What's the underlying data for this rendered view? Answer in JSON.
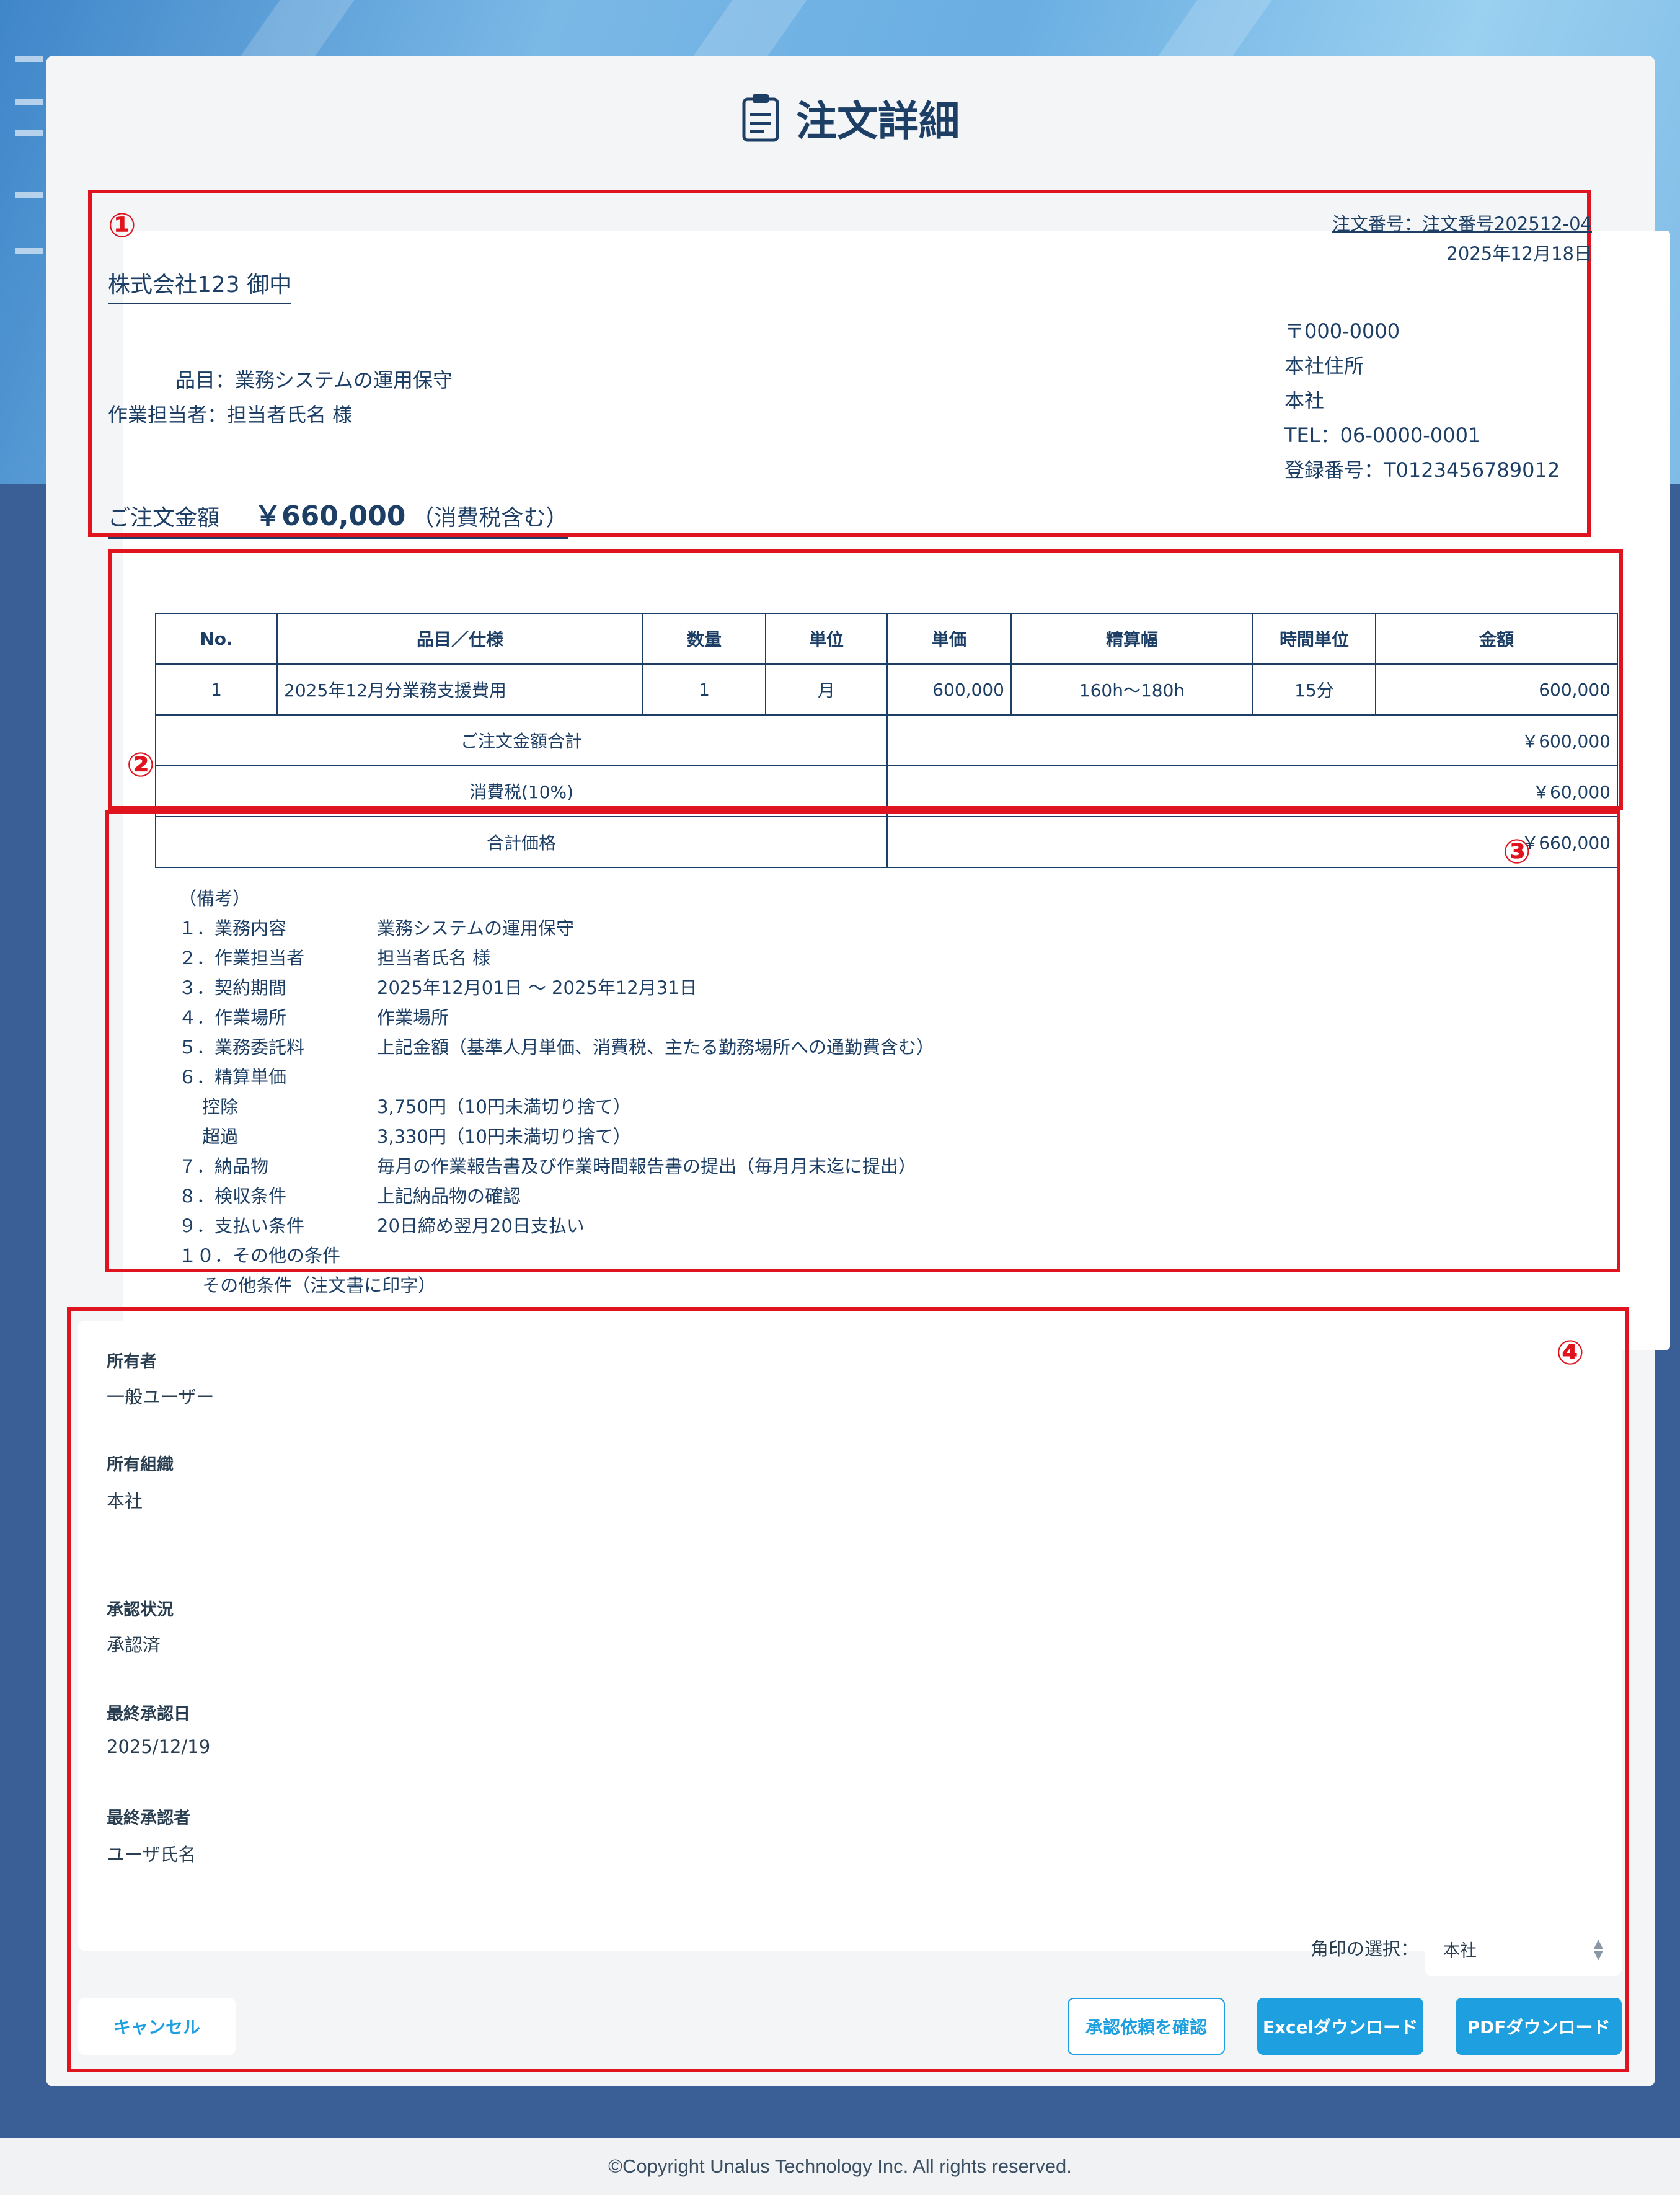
{
  "page": {
    "title": "注文詳細",
    "footer": "©Copyright Unalus Technology Inc. All rights reserved.",
    "annotations": [
      "①",
      "②",
      "③",
      "④"
    ]
  },
  "header": {
    "order_number": "注文番号：注文番号202512-04",
    "date": "2025年12月18日",
    "recipient": "株式会社123 御中",
    "item_line": "品目：業務システムの運用保守",
    "person_line": "作業担当者：担当者氏名 様",
    "company": [
      "〒000-0000",
      "本社住所",
      "本社",
      "TEL：06-0000-0001",
      "登録番号：T0123456789012"
    ],
    "amount_label": "ご注文金額",
    "amount_value": "￥660,000",
    "amount_note": "（消費税含む）"
  },
  "table": {
    "headers": [
      "No.",
      "品目／仕様",
      "数量",
      "単位",
      "単価",
      "精算幅",
      "時間単位",
      "金額"
    ],
    "row": [
      "1",
      "2025年12月分業務支援費用",
      "1",
      "月",
      "600,000",
      "160h～180h",
      "15分",
      "600,000"
    ],
    "totals": [
      {
        "label": "ご注文金額合計",
        "value": "￥600,000"
      },
      {
        "label": "消費税(10%)",
        "value": "￥60,000"
      },
      {
        "label": "合計価格",
        "value": "￥660,000"
      }
    ]
  },
  "remarks": {
    "heading": "（備考）",
    "items": [
      {
        "k": "１．業務内容",
        "v": "業務システムの運用保守"
      },
      {
        "k": "２．作業担当者",
        "v": "担当者氏名 様"
      },
      {
        "k": "３．契約期間",
        "v": "2025年12月01日 ～ 2025年12月31日"
      },
      {
        "k": "４．作業場所",
        "v": "作業場所"
      },
      {
        "k": "５．業務委託料",
        "v": "上記金額（基準人月単価、消費税、主たる勤務場所への通勤費含む）"
      },
      {
        "k": "６．精算単価",
        "v": ""
      },
      {
        "k": "　 控除",
        "v": "3,750円（10円未満切り捨て）"
      },
      {
        "k": "　 超過",
        "v": "3,330円（10円未満切り捨て）"
      },
      {
        "k": "７．納品物",
        "v": "毎月の作業報告書及び作業時間報告書の提出（毎月月末迄に提出）"
      },
      {
        "k": "８．検収条件",
        "v": "上記納品物の確認"
      },
      {
        "k": "９．支払い条件",
        "v": "20日締め翌月20日支払い"
      },
      {
        "k": "１０．その他の条件",
        "v": ""
      },
      {
        "k": "　 その他条件（注文書に印字）",
        "v": ""
      }
    ]
  },
  "details": {
    "owner_label": "所有者",
    "owner_value": "一般ユーザー",
    "org_label": "所有組織",
    "org_value": "本社",
    "status_label": "承認状況",
    "status_value": "承認済",
    "approved_date_label": "最終承認日",
    "approved_date_value": "2025/12/19",
    "approver_label": "最終承認者",
    "approver_value": "ユーザ氏名"
  },
  "controls": {
    "seal_label": "角印の選択：",
    "seal_selected": "本社",
    "cancel": "キャンセル",
    "confirm_request": "承認依頼を確認",
    "excel": "Excelダウンロード",
    "pdf": "PDFダウンロード"
  },
  "colors": {
    "accent": "#1d9fe0",
    "annotation": "#e0141e",
    "text": "#1d3f66"
  }
}
